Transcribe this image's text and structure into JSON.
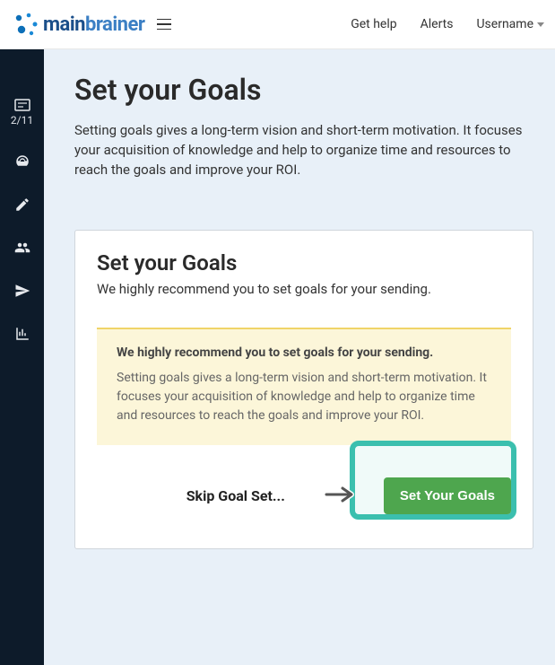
{
  "topbar": {
    "logo_main": "main",
    "logo_brain": "brainer",
    "nav": {
      "get_help": "Get help",
      "alerts": "Alerts",
      "username": "Username"
    }
  },
  "sidebar": {
    "counter": "2/11"
  },
  "page": {
    "title": "Set your Goals",
    "description": "Setting goals gives a long-term vision and short-term motivation. It focuses your acquisition of knowledge and help to organize time and resources to reach the goals and improve your ROI."
  },
  "card": {
    "title": "Set your Goals",
    "subtitle": "We highly recommend you to set goals for your sending.",
    "alert": {
      "title": "We highly recommend you to set goals for your sending.",
      "body": "Setting goals gives a long-term vision and short-term motivation. It focuses your acquisition of knowledge and help to organize time and resources to reach the goals and improve your ROI."
    },
    "skip_label": "Skip Goal Set...",
    "primary_label": "Set Your Goals"
  }
}
